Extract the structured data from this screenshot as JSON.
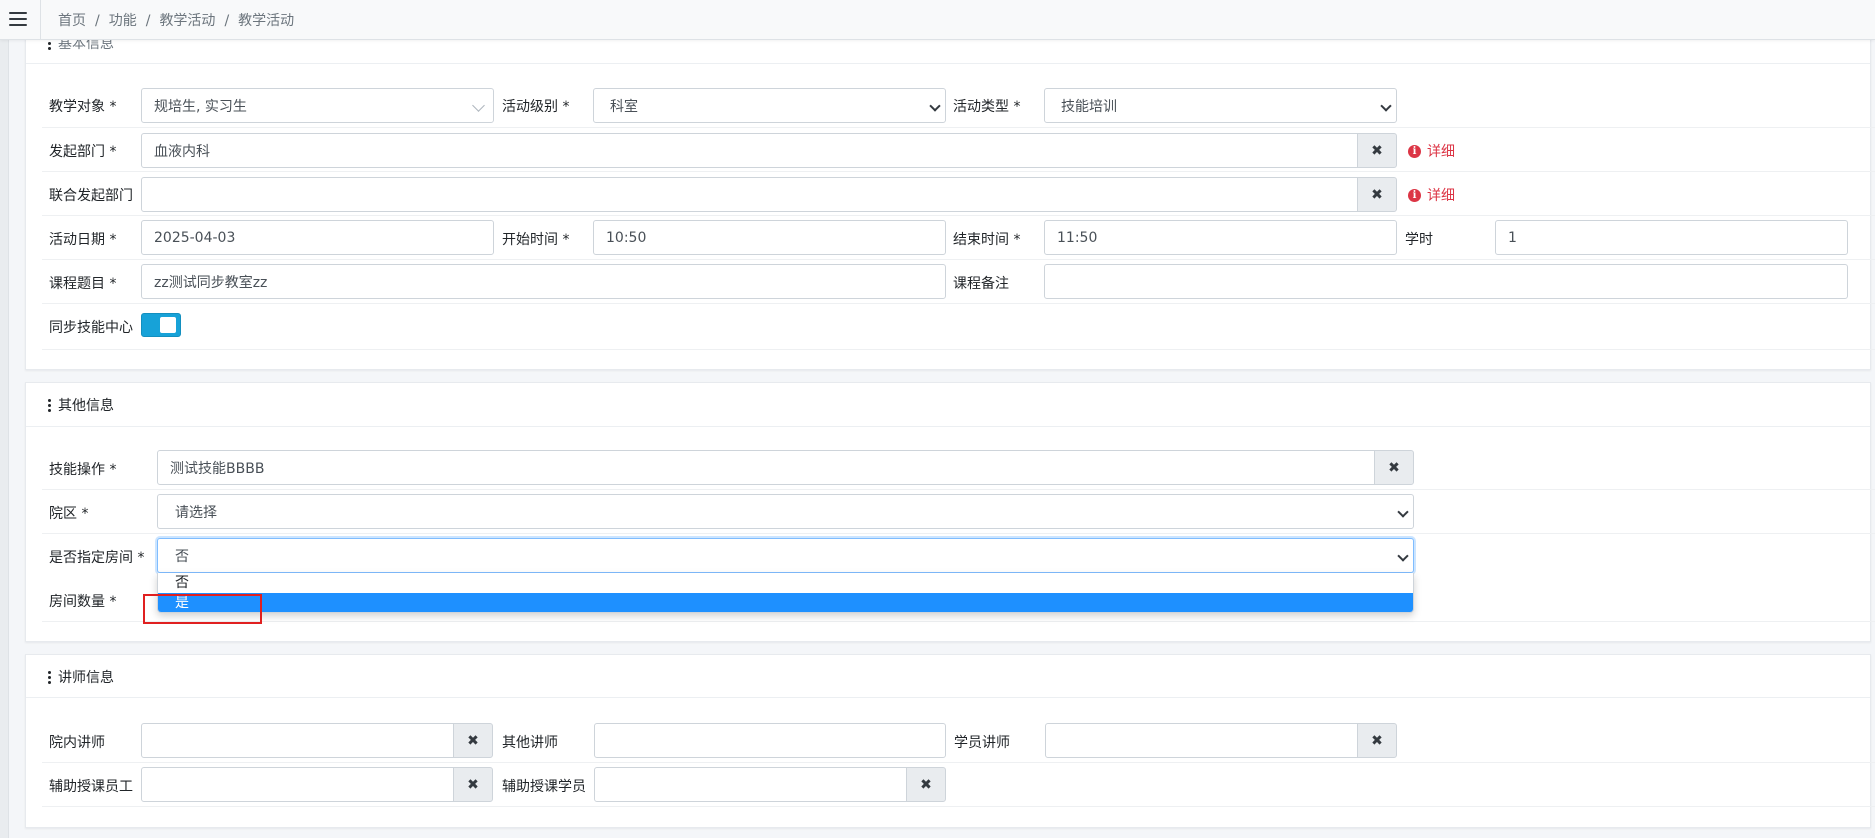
{
  "breadcrumb": [
    "首页",
    "功能",
    "教学活动",
    "教学活动"
  ],
  "basic": {
    "title_partial": "基本信息",
    "teaching_target_label": "教学对象 *",
    "teaching_target_value": "规培生, 实习生",
    "activity_level_label": "活动级别 *",
    "activity_level_value": "科室",
    "activity_type_label": "活动类型 *",
    "activity_type_value": "技能培训",
    "dept_label": "发起部门 *",
    "dept_value": "血液内科",
    "detail_label": "详细",
    "joint_dept_label": "联合发起部门",
    "joint_dept_value": "",
    "date_label": "活动日期 *",
    "date_value": "2025-04-03",
    "start_label": "开始时间 *",
    "start_value": "10:50",
    "end_label": "结束时间 *",
    "end_value": "11:50",
    "hours_label": "学时",
    "hours_value": "1",
    "course_label": "课程题目 *",
    "course_value": "zz测试同步教室zz",
    "note_label": "课程备注",
    "note_value": "",
    "sync_label": "同步技能中心",
    "sync_on": true
  },
  "other": {
    "title": "其他信息",
    "skill_label": "技能操作 *",
    "skill_value": "测试技能BBBB",
    "campus_label": "院区 *",
    "campus_value": "请选择",
    "room_label": "是否指定房间 *",
    "room_value": "否",
    "room_count_label": "房间数量 *",
    "options": [
      "否",
      "是"
    ],
    "highlighted_option": "是"
  },
  "teacher": {
    "title": "讲师信息",
    "inner_label": "院内讲师",
    "other_label": "其他讲师",
    "student_label": "学员讲师",
    "assist_staff_label": "辅助授课员工",
    "assist_student_label": "辅助授课学员"
  },
  "colors": {
    "accent": "#17a2d8",
    "danger": "#dc3545",
    "selected": "#1e90ff",
    "highlight": "#e02020"
  }
}
